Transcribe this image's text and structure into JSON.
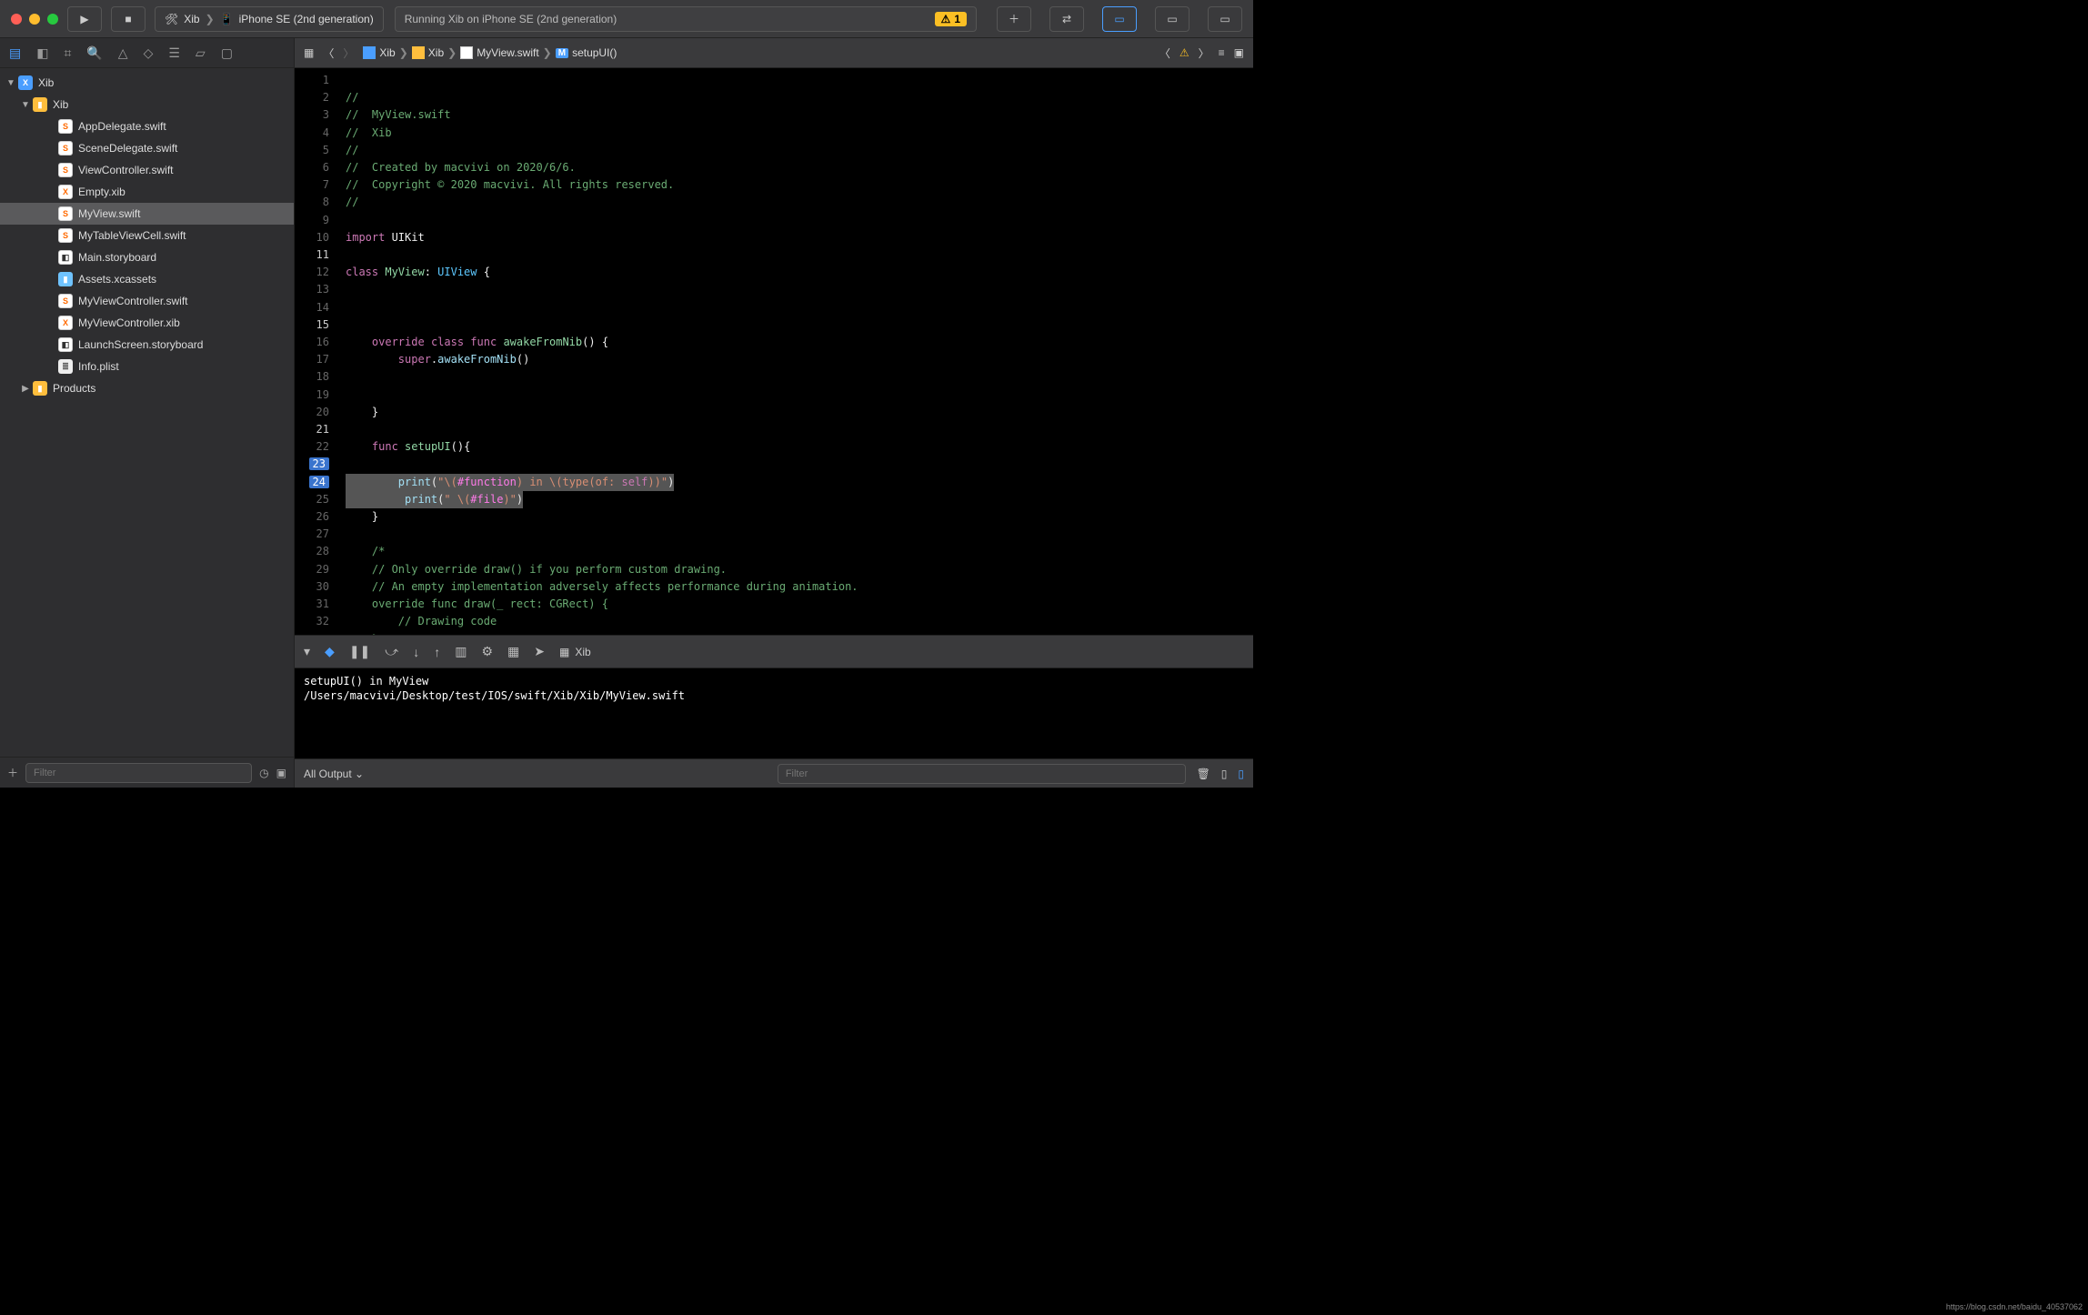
{
  "toolbar": {
    "scheme_app": "Xib",
    "scheme_device": "iPhone SE (2nd generation)",
    "activity_text": "Running Xib on iPhone SE (2nd generation)",
    "warning_count": "1"
  },
  "navigator": {
    "root": "Xib",
    "group": "Xib",
    "files": [
      "AppDelegate.swift",
      "SceneDelegate.swift",
      "ViewController.swift",
      "Empty.xib",
      "MyView.swift",
      "MyTableViewCell.swift",
      "Main.storyboard",
      "Assets.xcassets",
      "MyViewController.swift",
      "MyViewController.xib",
      "LaunchScreen.storyboard",
      "Info.plist"
    ],
    "products": "Products",
    "filter_placeholder": "Filter"
  },
  "jump": {
    "c1": "Xib",
    "c2": "Xib",
    "c3": "MyView.swift",
    "c4": "setupUI()"
  },
  "code": {
    "l1": "//",
    "l2a": "//  ",
    "l2b": "MyView.swift",
    "l3a": "//  ",
    "l3b": "Xib",
    "l4": "//",
    "l5a": "//  ",
    "l5b": "Created by macvivi on 2020/6/6.",
    "l6a": "//  ",
    "l6b": "Copyright © 2020 macvivi. All rights reserved.",
    "l7": "//",
    "l9a": "import",
    "l9b": " UIKit",
    "l11a": "class",
    "l11b": " MyView",
    "l11c": ": ",
    "l11d": "UIView",
    "l11e": " {",
    "l15a": "    ",
    "l15b": "override",
    "l15c": " ",
    "l15d": "class",
    "l15e": " ",
    "l15f": "func",
    "l15g": " ",
    "l15h": "awakeFromNib",
    "l15i": "() {",
    "l16a": "        ",
    "l16b": "super",
    "l16c": ".",
    "l16d": "awakeFromNib",
    "l16e": "()",
    "l19": "    }",
    "l21a": "    ",
    "l21b": "func",
    "l21c": " ",
    "l21d": "setupUI",
    "l21e": "(){",
    "l23a": "        ",
    "l23b": "print",
    "l23c": "(",
    "l23d": "\"\\(",
    "l23e": "#function",
    "l23f": ")",
    "l23g": " in ",
    "l23h": "\\(type(of: ",
    "l23i": "self",
    "l23j": "))\"",
    "l23k": ")",
    "l24a": "         ",
    "l24b": "print",
    "l24c": "(",
    "l24d": "\" \\(",
    "l24e": "#file",
    "l24f": ")\"",
    "l24g": ")",
    "l25": "    }",
    "l27": "    /*",
    "l28": "    // Only override draw() if you perform custom drawing.",
    "l29": "    // An empty implementation adversely affects performance during animation.",
    "l30": "    override func draw(_ rect: CGRect) {",
    "l31": "        // Drawing code",
    "l32": "    }"
  },
  "gutter": {
    "n1": "1",
    "n2": "2",
    "n3": "3",
    "n4": "4",
    "n5": "5",
    "n6": "6",
    "n7": "7",
    "n8": "8",
    "n9": "9",
    "n10": "10",
    "n11": "11",
    "n12": "12",
    "n13": "13",
    "n14": "14",
    "n15": "15",
    "n16": "16",
    "n17": "17",
    "n18": "18",
    "n19": "19",
    "n20": "20",
    "n21": "21",
    "n22": "22",
    "n23": "23",
    "n24": "24",
    "n25": "25",
    "n26": "26",
    "n27": "27",
    "n28": "28",
    "n29": "29",
    "n30": "30",
    "n31": "31",
    "n32": "32"
  },
  "debug_target": "Xib",
  "console": {
    "line1": "setupUI() in MyView",
    "line2": "/Users/macvivi/Desktop/test/IOS/swift/Xib/Xib/MyView.swift"
  },
  "console_footer": {
    "output_mode": "All Output",
    "filter_placeholder": "Filter"
  },
  "watermark": "https://blog.csdn.net/baidu_40537062"
}
